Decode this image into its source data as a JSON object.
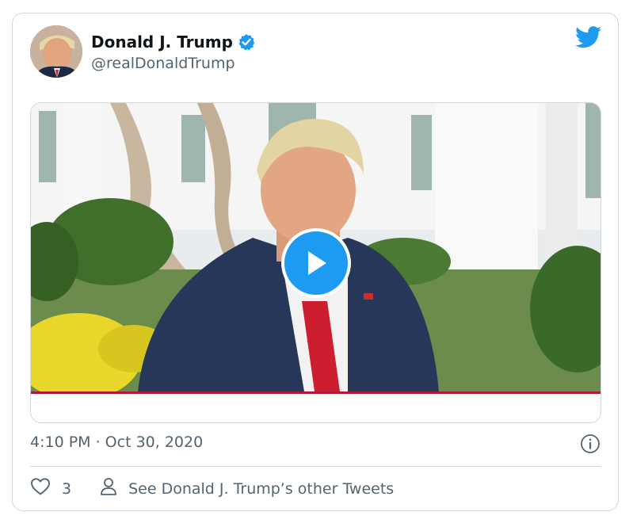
{
  "tweet": {
    "author_name": "Donald J. Trump",
    "author_handle": "@realDonaldTrump",
    "timestamp": "4:10 PM · Oct 30, 2020",
    "like_count": "3",
    "other_tweets_label": "See Donald J. Trump’s other Tweets"
  },
  "icons": {
    "verified": "verified-badge-icon",
    "brand": "twitter-bird-icon",
    "play": "play-icon",
    "info": "info-icon",
    "like": "heart-icon",
    "profile": "person-icon"
  },
  "colors": {
    "twitter_blue": "#1d9bf0",
    "text_secondary": "#536471",
    "border": "#cfd9de",
    "video_progress": "#b0193a"
  }
}
